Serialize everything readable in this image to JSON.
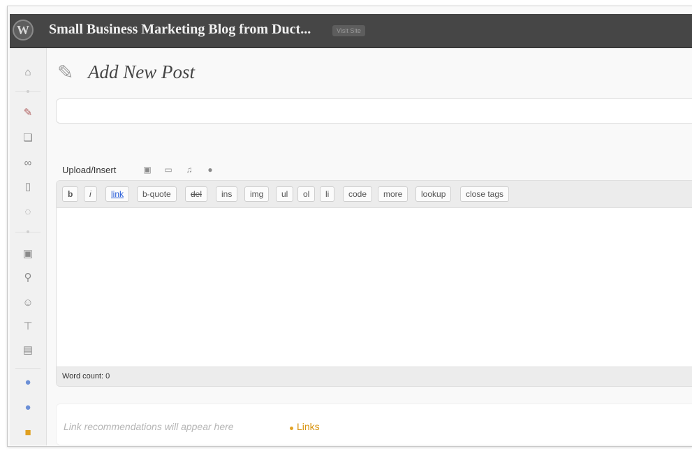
{
  "admin_bar": {
    "logo": "W",
    "site_title": "Small Business Marketing Blog from Duct...",
    "visit_site": "Visit Site"
  },
  "sidebar": {
    "icons": [
      "home-icon",
      "posts-pin-icon",
      "media-icon",
      "links-icon",
      "pages-icon",
      "comments-icon",
      "appearance-icon",
      "plugins-icon",
      "users-icon",
      "tools-icon",
      "settings-icon",
      "plugin-sphere-icon",
      "plugin-sphere-icon-2",
      "lock-icon"
    ]
  },
  "page": {
    "title": "Add New Post",
    "title_placeholder": ""
  },
  "upload": {
    "label": "Upload/Insert"
  },
  "quicktags": [
    "b",
    "i",
    "link",
    "b-quote",
    "del",
    "ins",
    "img",
    "ul",
    "ol",
    "li",
    "code",
    "more",
    "lookup",
    "close tags"
  ],
  "editor": {
    "word_count": "Word count: 0"
  },
  "links_box": {
    "recommendation": "Link recommendations will appear here",
    "tab": "Links"
  },
  "colors": {
    "admin_bar": "#464646",
    "link_accent": "#d8930f",
    "quicktag_link": "#2259d8"
  }
}
